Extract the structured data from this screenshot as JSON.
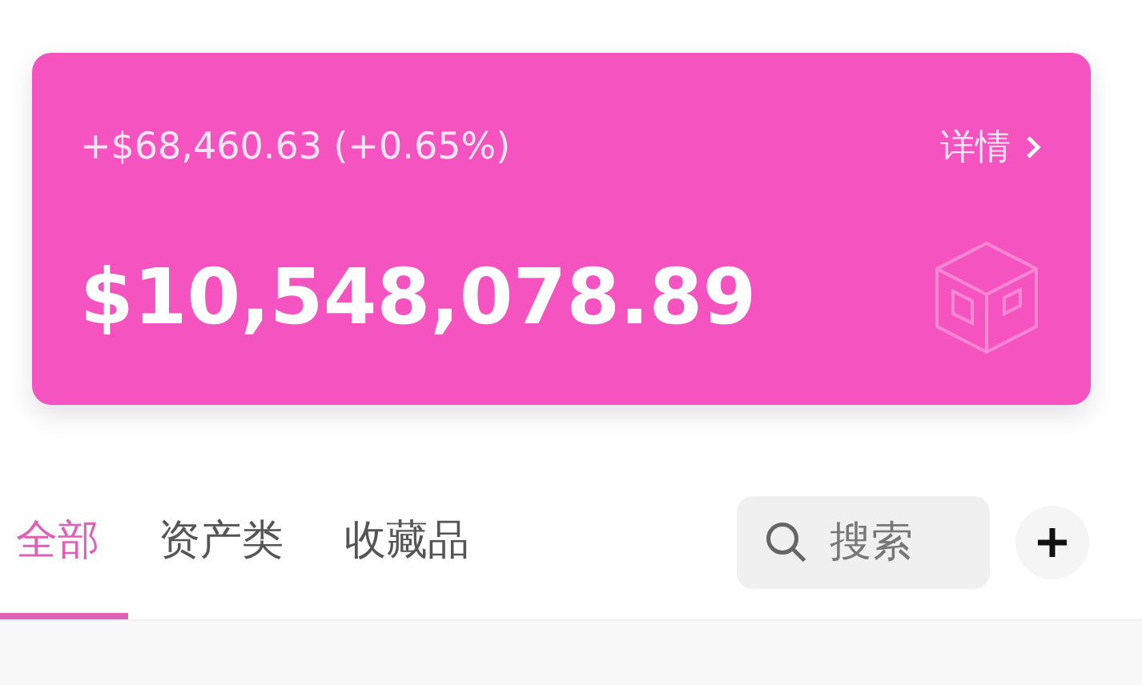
{
  "balance_card": {
    "change": "+$68,460.63 (+0.65%)",
    "details_link": "详情",
    "total": "$10,548,078.89"
  },
  "tabs": [
    {
      "label": "全部",
      "selected": true
    },
    {
      "label": "资产类",
      "selected": false
    },
    {
      "label": "收藏品",
      "selected": false
    }
  ],
  "search": {
    "placeholder": "搜索"
  }
}
